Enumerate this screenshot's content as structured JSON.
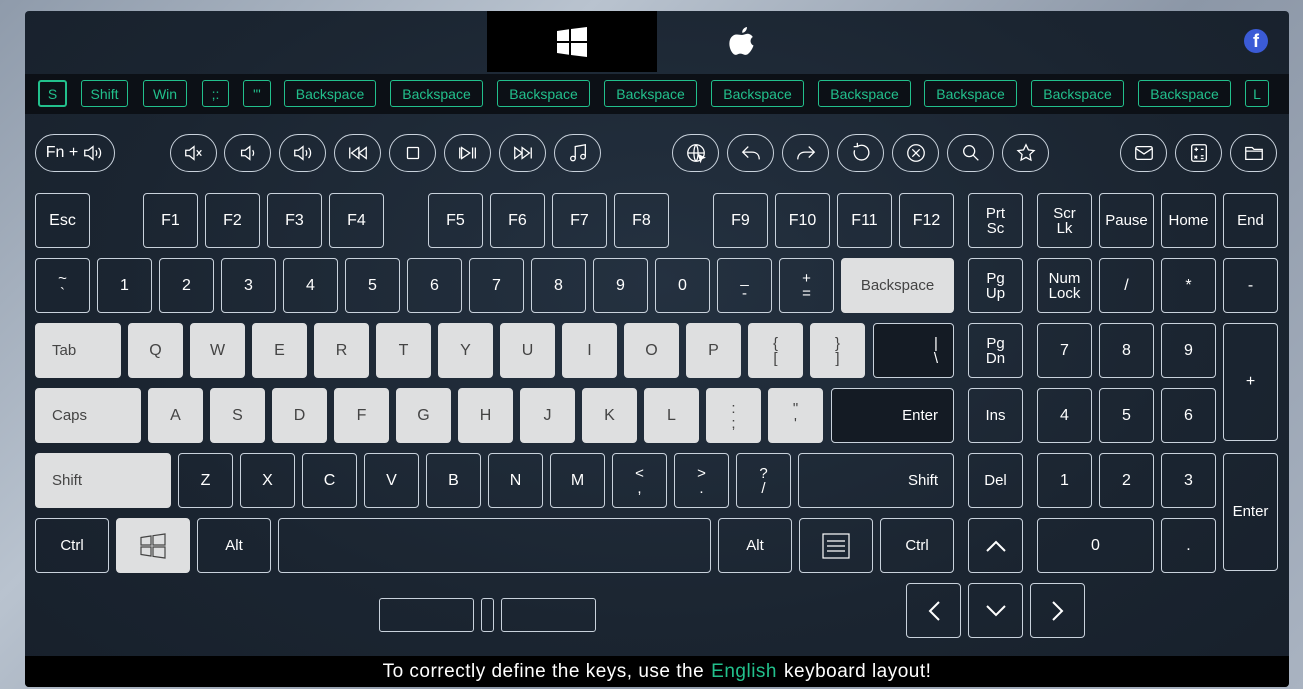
{
  "os_tabs": [
    {
      "name": "windows",
      "icon": "windows-logo-icon",
      "active": true
    },
    {
      "name": "apple",
      "icon": "apple-logo-icon",
      "active": false
    }
  ],
  "social": {
    "icon": "facebook-icon",
    "label": "f"
  },
  "history": [
    "S",
    "Shift",
    "Win",
    ";:",
    "\"'",
    "Backspace",
    "Backspace",
    "Backspace",
    "Backspace",
    "Backspace",
    "Backspace",
    "Backspace",
    "Backspace",
    "Backspace",
    "L"
  ],
  "media_row": {
    "fn_label": "Fn +",
    "icons": [
      "volume-icon",
      "mute-icon",
      "volume-down-icon",
      "volume-up-icon",
      "previous-track-icon",
      "stop-icon",
      "play-pause-icon",
      "next-track-icon",
      "music-icon",
      "browser-icon",
      "back-icon",
      "forward-icon",
      "refresh-icon",
      "stop-load-icon",
      "search-icon",
      "favorites-icon",
      "mail-icon",
      "calculator-icon",
      "folder-icon"
    ]
  },
  "fkeys": {
    "esc": "Esc",
    "f": [
      "F1",
      "F2",
      "F3",
      "F4",
      "F5",
      "F6",
      "F7",
      "F8",
      "F9",
      "F10",
      "F11",
      "F12"
    ],
    "prtsc": [
      "Prt",
      "Sc"
    ],
    "scrlk": [
      "Scr",
      "Lk"
    ],
    "pause": "Pause",
    "home": "Home",
    "end": "End"
  },
  "number_row": {
    "tilde": [
      "~",
      "`"
    ],
    "digits": [
      "1",
      "2",
      "3",
      "4",
      "5",
      "6",
      "7",
      "8",
      "9",
      "0"
    ],
    "minus": [
      "_",
      "-"
    ],
    "plus": [
      "+",
      "="
    ],
    "backspace": "Backspace",
    "pgup": [
      "Pg",
      "Up"
    ],
    "numlock": [
      "Num",
      "Lock"
    ],
    "slash": "/",
    "star": "*",
    "dash": "-"
  },
  "row_q": {
    "tab": "Tab",
    "letters": [
      "Q",
      "W",
      "E",
      "R",
      "T",
      "Y",
      "U",
      "I",
      "O",
      "P"
    ],
    "lbrace": [
      "{",
      "["
    ],
    "rbrace": [
      "}",
      "]"
    ],
    "pipe": [
      "|",
      "\\"
    ],
    "pgdn": [
      "Pg",
      "Dn"
    ],
    "n7": "7",
    "n8": "8",
    "n9": "9",
    "nplus": "+"
  },
  "row_a": {
    "caps": "Caps",
    "letters": [
      "A",
      "S",
      "D",
      "F",
      "G",
      "H",
      "J",
      "K",
      "L"
    ],
    "semicolon": [
      ":",
      ";"
    ],
    "quote": [
      "\"",
      "'"
    ],
    "enter": "Enter",
    "ins": "Ins",
    "n4": "4",
    "n5": "5",
    "n6": "6"
  },
  "row_z": {
    "lshift": "Shift",
    "letters": [
      "Z",
      "X",
      "C",
      "V",
      "B",
      "N",
      "M"
    ],
    "comma": [
      "<",
      ","
    ],
    "period": [
      ">",
      "."
    ],
    "question": [
      "?",
      "/"
    ],
    "rshift": "Shift",
    "del": "Del",
    "n1": "1",
    "n2": "2",
    "n3": "3",
    "nenter": "Enter"
  },
  "row_bottom": {
    "lctrl": "Ctrl",
    "lalt": "Alt",
    "ralt": "Alt",
    "rctrl": "Ctrl",
    "n0": "0",
    "ndot": "."
  },
  "footer": {
    "before": "To correctly define the keys, use the",
    "highlight": "English",
    "after": "keyboard layout!"
  },
  "colors": {
    "accent": "#22c08c",
    "pressed_key": "#dedfe0",
    "background": "#1d2733"
  }
}
